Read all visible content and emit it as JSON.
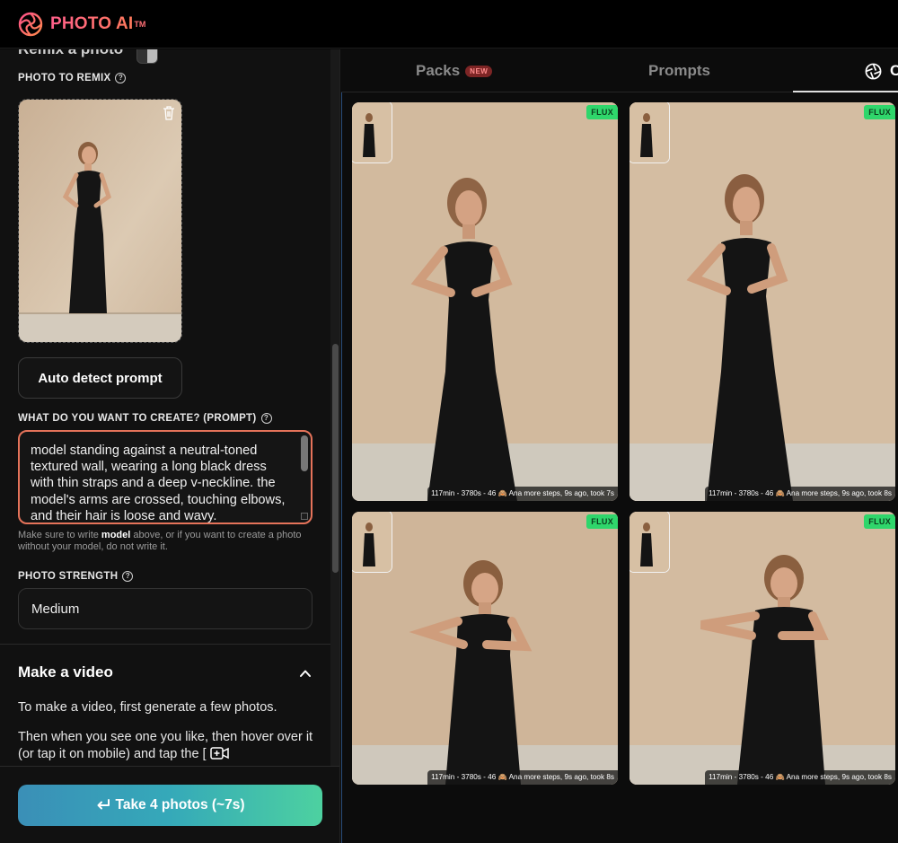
{
  "app": {
    "brand": "PHOTO AI",
    "trademark": "TM"
  },
  "sidebar": {
    "section_title_partial": "Remix a photo",
    "photo_to_remix_label": "PHOTO TO REMIX",
    "auto_detect_label": "Auto detect prompt",
    "prompt_label": "WHAT DO YOU WANT TO CREATE? (PROMPT)",
    "prompt_value": "model standing against a neutral-toned textured wall, wearing a long black dress with thin straps and a deep v-neckline. the model's arms are crossed, touching elbows, and their hair is loose and wavy.",
    "hint_prefix": "Make sure to write ",
    "hint_bold": "model",
    "hint_suffix": " above, or if you want to create a photo without your model, do not write it.",
    "photo_strength_label": "PHOTO STRENGTH",
    "photo_strength_value": "Medium",
    "video_section_title": "Make a video",
    "video_text_1": "To make a video, first generate a few photos.",
    "video_text_2": "Then when you see one you like, then hover over it (or tap it on mobile) and tap the [",
    "take_photos_label": "Take 4 photos (~7s)"
  },
  "tabs": [
    {
      "label": "Packs",
      "badge": "NEW"
    },
    {
      "label": "Prompts"
    },
    {
      "label": "C"
    }
  ],
  "gallery": {
    "badge": "FLUX",
    "items": [
      {
        "meta": "117min - 3780s - 46 🙈 Ana more steps, 9s ago, took 7s"
      },
      {
        "meta": "117min - 3780s - 46 🙈 Ana more steps, 9s ago, took 8s"
      },
      {
        "meta": "117min - 3780s - 46 🙈 Ana more steps, 9s ago, took 8s"
      },
      {
        "meta": "117min - 3780s - 46 🙈 Ana more steps, 9s ago, took 8s"
      }
    ]
  },
  "colors": {
    "accent_prompt_border": "#e5735a",
    "flux_badge": "#2fd66b",
    "cta_gradient_start": "#3a8fb7",
    "cta_gradient_end": "#4dd1a0"
  },
  "icons": {
    "logo": "aperture-swirl-icon",
    "help": "question-circle-icon",
    "trash": "trash-icon",
    "chevron": "chevron-up-icon",
    "enter": "enter-arrow-icon",
    "video_add": "video-plus-icon",
    "tab_active": "aperture-icon"
  }
}
